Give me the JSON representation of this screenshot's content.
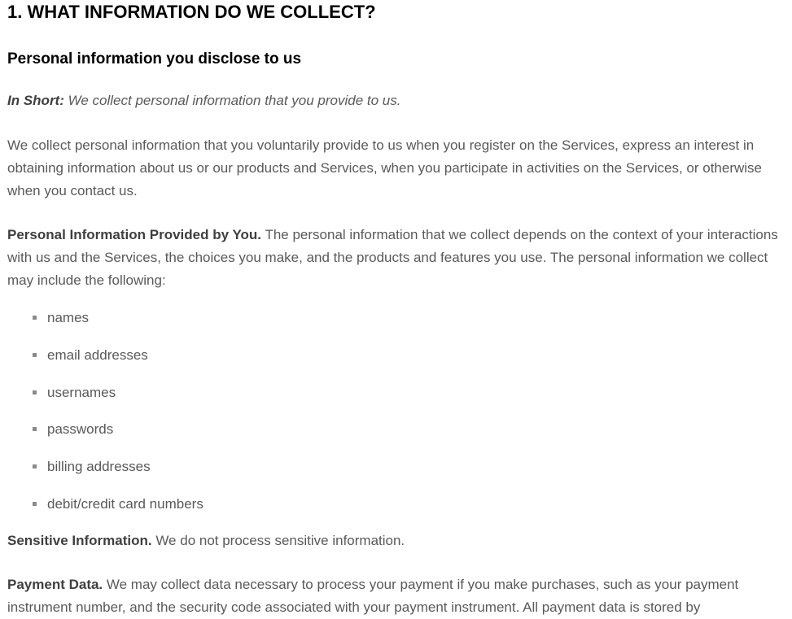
{
  "section": {
    "title": "1. WHAT INFORMATION DO WE COLLECT?",
    "subtitle": "Personal information you disclose to us"
  },
  "in_short": {
    "label": "In Short:",
    "text": " We collect personal information that you provide to us."
  },
  "paragraph1": "We collect personal information that you voluntarily provide to us when you register on the Services, express an interest in obtaining information about us or our products and Services, when you participate in activities on the Services, or otherwise when you contact us.",
  "paragraph2": {
    "lead": "Personal Information Provided by You.",
    "text": " The personal information that we collect depends on the context of your interactions with us and the Services, the choices you make, and the products and features you use. The personal information we collect may include the following:"
  },
  "list_items": [
    "names",
    "email addresses",
    "usernames",
    "passwords",
    "billing addresses",
    "debit/credit card numbers"
  ],
  "sensitive": {
    "lead": "Sensitive Information.",
    "text": " We do not process sensitive information."
  },
  "payment": {
    "lead": "Payment Data.",
    "text": " We may collect data necessary to process your payment if you make purchases, such as your payment instrument number, and the security code associated with your payment instrument. All payment data is stored by"
  }
}
